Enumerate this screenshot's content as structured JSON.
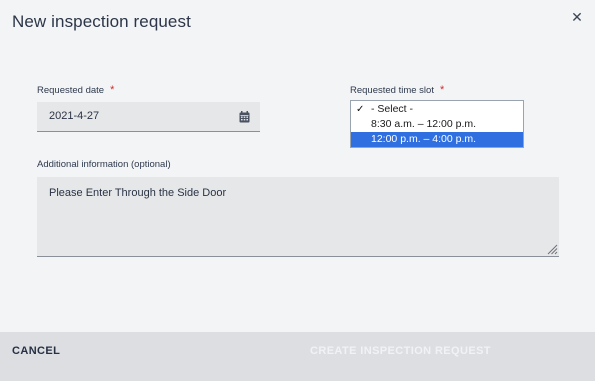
{
  "dialog": {
    "title": "New inspection request",
    "close_icon": "close-icon"
  },
  "form": {
    "requested_date": {
      "label": "Requested date",
      "required_mark": "*",
      "value": "2021-4-27",
      "icon": "calendar-icon"
    },
    "time_slot": {
      "label": "Requested time slot",
      "required_mark": "*",
      "checked_option": "- Select -",
      "highlighted_option": "12:00 p.m. – 4:00 p.m.",
      "options": [
        "- Select -",
        "8:30 a.m. – 12:00 p.m.",
        "12:00 p.m. – 4:00 p.m."
      ]
    },
    "additional_info": {
      "label": "Additional information (optional)",
      "value": "Please Enter Through the Side Door"
    }
  },
  "footer": {
    "cancel_label": "CANCEL",
    "create_label": "CREATE INSPECTION REQUEST"
  },
  "colors": {
    "accent": "#2f6fe0",
    "required": "#d32b2b",
    "background": "#f3f4f6",
    "footer": "#dcdee2"
  }
}
